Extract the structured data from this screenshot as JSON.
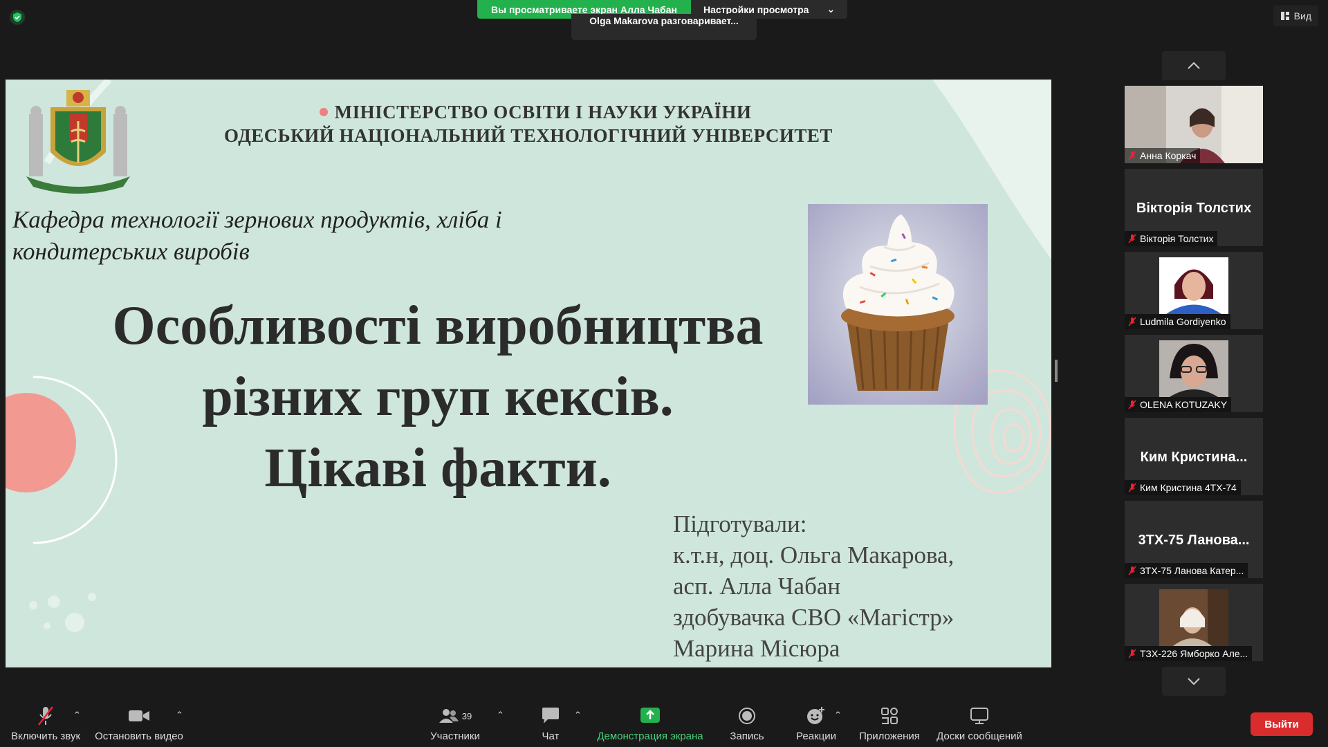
{
  "top": {
    "share_banner": "Вы просматриваете экран Алла Чабан",
    "view_settings": "Настройки просмотра",
    "talking": "Olga Makarova разговаривает...",
    "view_button": "Вид"
  },
  "slide": {
    "ministry_line1": "МІНІСТЕРСТВО ОСВІТИ І НАУКИ УКРАЇНИ",
    "ministry_line2": "ОДЕСЬКИЙ НАЦІОНАЛЬНИЙ ТЕХНОЛОГІЧНИЙ УНІВЕРСИТЕТ",
    "kafedra_line1": "Кафедра технології зернових продуктів, хліба і",
    "kafedra_line2": "кондитерських виробів",
    "title_line1": "Особливості виробництва",
    "title_line2": "різних груп кексів.",
    "title_line3": "Цікаві факти.",
    "prepared_lines": [
      "Підготували:",
      "к.т.н, доц. Ольга Макарова,",
      "асп. Алла Чабан",
      "здобувачка СВО «Магістр»",
      "Марина Місюра"
    ]
  },
  "participants": [
    {
      "label": "Анна Коркач",
      "big_name": "",
      "type": "video-room"
    },
    {
      "label": "Вікторія Толстих",
      "big_name": "Вікторія Толстих",
      "type": "name"
    },
    {
      "label": "Ludmila Gordiyenko",
      "big_name": "",
      "type": "photo-blue"
    },
    {
      "label": "OLENA KOTUZAKY",
      "big_name": "",
      "type": "photo-glasses"
    },
    {
      "label": "Ким Кристина 4ТХ-74",
      "big_name": "Ким  Кристина...",
      "type": "name"
    },
    {
      "label": "3ТХ-75 Ланова Катер...",
      "big_name": "3ТХ-75  Ланова...",
      "type": "name"
    },
    {
      "label": "ТЗХ-226 Ямборко Але...",
      "big_name": "",
      "type": "photo-room"
    }
  ],
  "toolbar": {
    "mute": "Включить звук",
    "video": "Остановить видео",
    "participants": "Участники",
    "participants_count": "39",
    "chat": "Чат",
    "share": "Демонстрация экрана",
    "record": "Запись",
    "reactions": "Реакции",
    "apps": "Приложения",
    "boards": "Доски сообщений",
    "leave": "Выйти"
  },
  "colors": {
    "share_green": "#22b14c",
    "slide_bg": "#cfe6dc",
    "leave_red": "#d92c2c"
  }
}
